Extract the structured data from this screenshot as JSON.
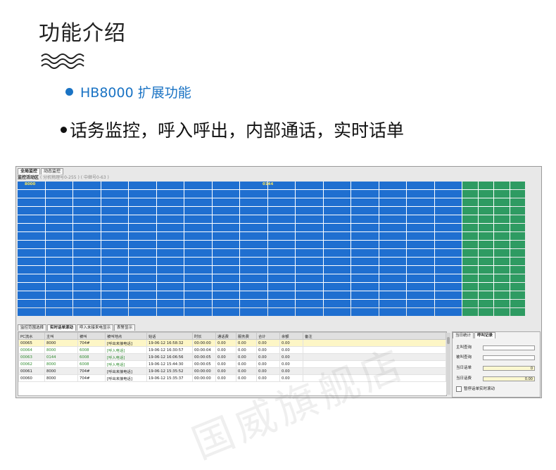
{
  "heading": "功能介绍",
  "subtitle1": "HB8000 扩展功能",
  "subtitle2": "话务监控，呼入呼出，内部通话，实时话单",
  "colors": {
    "accent": "#1a73c4",
    "grid_blue": "#1f6fd0",
    "grid_green": "#2e9b62"
  },
  "screenshot": {
    "top_tabs": [
      "全局监控",
      "动态监控"
    ],
    "area_label": "监控活动区",
    "area_hint": "( 分机物理号0-255 ) ( 中继号0-63 )",
    "ext_a": "8000",
    "ext_b": "0144",
    "bottom_tabs": [
      "监控范围选择",
      "实时话单滚动",
      "呼入未接来电显示",
      "表警显示"
    ],
    "columns": [
      "PC流水",
      "主叫",
      "被叫",
      "被叫地点",
      "始话",
      "时长",
      "通话费",
      "服务费",
      "合计",
      "余额",
      "备注"
    ],
    "rows": [
      {
        "id": "00065",
        "caller": "8000",
        "callee": "704#",
        "place": "[呼出未接电话]",
        "start": "19-06-12 16:58:32",
        "dur": "00:00:00",
        "fee": "0.00",
        "svc": "0.00",
        "total": "0.00",
        "bal": "0.00",
        "note": ""
      },
      {
        "id": "00064",
        "caller": "8000",
        "callee": "6008",
        "place": "[呼入电话]",
        "start": "19-06-12 16:30:57",
        "dur": "00:00:04",
        "fee": "0.00",
        "svc": "0.00",
        "total": "0.00",
        "bal": "0.00",
        "note": ""
      },
      {
        "id": "00063",
        "caller": "0144",
        "callee": "6008",
        "place": "[呼入电话]",
        "start": "19-06-12 16:06:56",
        "dur": "00:00:05",
        "fee": "0.00",
        "svc": "0.00",
        "total": "0.00",
        "bal": "0.00",
        "note": ""
      },
      {
        "id": "00062",
        "caller": "8000",
        "callee": "6008",
        "place": "[呼入电话]",
        "start": "19-06-12 15:44:30",
        "dur": "00:00:05",
        "fee": "0.00",
        "svc": "0.00",
        "total": "0.00",
        "bal": "0.00",
        "note": ""
      },
      {
        "id": "00061",
        "caller": "8000",
        "callee": "704#",
        "place": "[呼出未接电话]",
        "start": "19-06-12 15:35:52",
        "dur": "00:00:00",
        "fee": "0.00",
        "svc": "0.00",
        "total": "0.00",
        "bal": "0.00",
        "note": ""
      },
      {
        "id": "00060",
        "caller": "8000",
        "callee": "704#",
        "place": "[呼出未接电话]",
        "start": "19-06-12 15:35:37",
        "dur": "00:00:00",
        "fee": "0.00",
        "svc": "0.00",
        "total": "0.00",
        "bal": "0.00",
        "note": ""
      }
    ],
    "right_tabs": [
      "当日统计",
      "呼叫记录"
    ],
    "right_fields": [
      {
        "label": "主叫查询",
        "value": ""
      },
      {
        "label": "被叫查询",
        "value": ""
      },
      {
        "label": "当日话单",
        "value": "0"
      },
      {
        "label": "当日话费",
        "value": "0.00"
      }
    ],
    "pause_label": "暂停话单实时滚动",
    "watermark": "国威旗舰店"
  }
}
